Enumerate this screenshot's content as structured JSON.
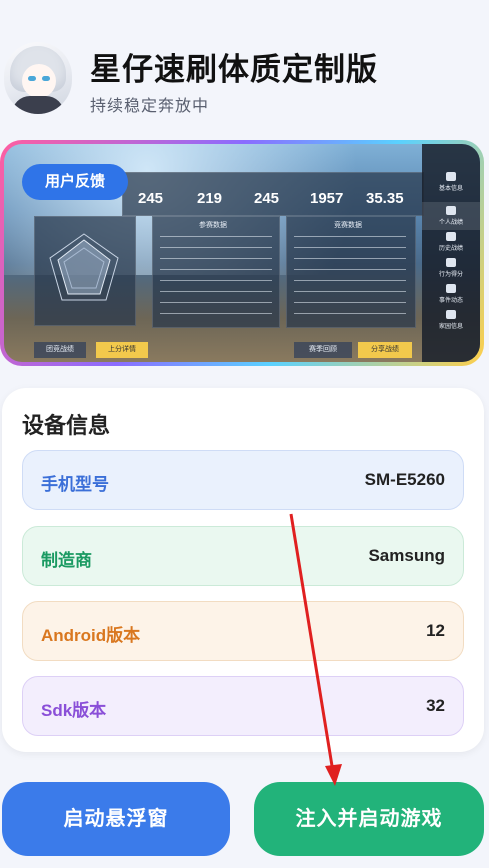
{
  "header": {
    "title": "星仔速刷体质定制版",
    "subtitle": "持续稳定奔放中"
  },
  "banner": {
    "feedback_label": "用户反馈",
    "stats": [
      "245",
      "219",
      "245",
      "1957",
      "35.35"
    ],
    "sidebar_items": [
      "基本信息",
      "个人战绩",
      "历史战绩",
      "行为得分",
      "事件动态",
      "家园信息"
    ],
    "panel_titles": [
      "参赛数据",
      "竞赛数据"
    ],
    "bottom_buttons": [
      "团竞战绩",
      "上分详情",
      "赛季回顾",
      "分享战绩"
    ]
  },
  "device_info": {
    "title": "设备信息",
    "rows": [
      {
        "key": "手机型号",
        "value": "SM-E5260"
      },
      {
        "key": "制造商",
        "value": "Samsung"
      },
      {
        "key": "Android版本",
        "value": "12"
      },
      {
        "key": "Sdk版本",
        "value": "32"
      }
    ]
  },
  "buttons": {
    "float_window": "启动悬浮窗",
    "inject_start": "注入并启动游戏"
  },
  "colors": {
    "primary_blue": "#3b7bea",
    "primary_green": "#22b37a",
    "annotation_arrow": "#e02020"
  }
}
